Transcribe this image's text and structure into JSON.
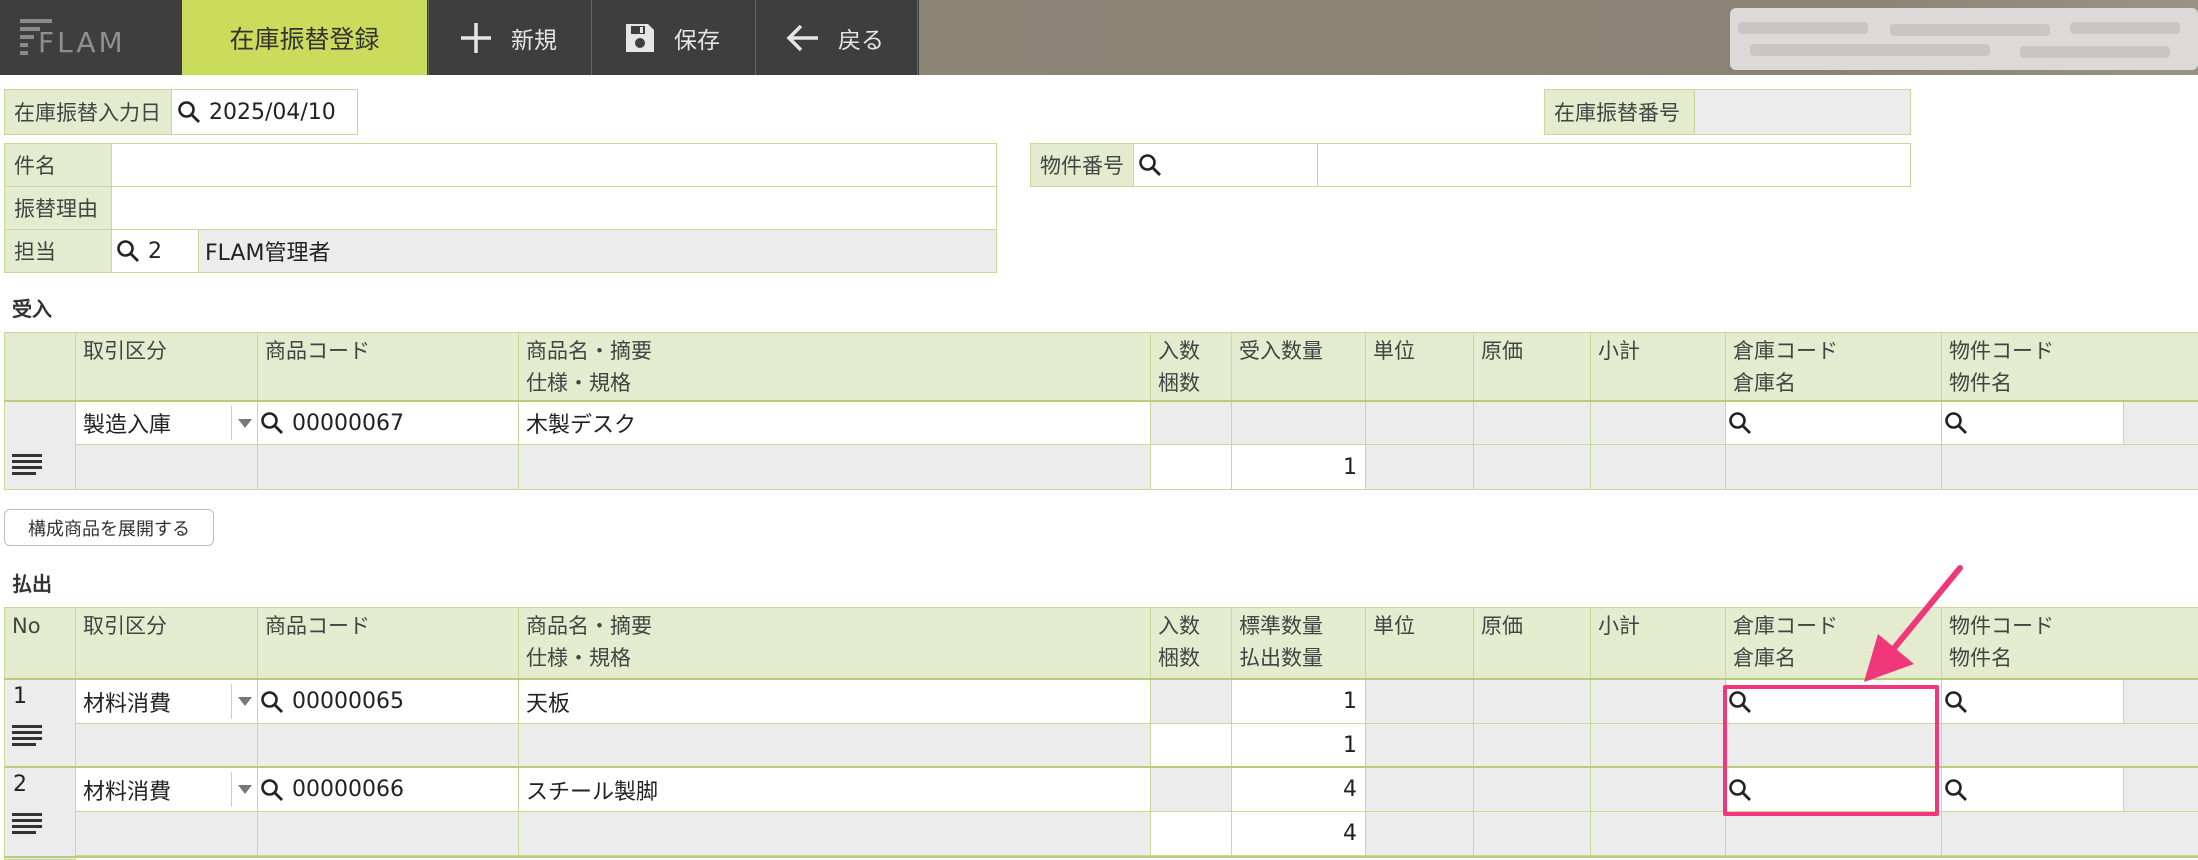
{
  "toolbar": {
    "logo_text": "FLAM",
    "active_tab": "在庫振替登録",
    "new_label": "新規",
    "save_label": "保存",
    "back_label": "戻る"
  },
  "form": {
    "date_label": "在庫振替入力日",
    "date_value": "2025/04/10",
    "number_label": "在庫振替番号",
    "number_value": "",
    "subject_label": "件名",
    "subject_value": "",
    "reason_label": "振替理由",
    "reason_value": "",
    "person_label": "担当",
    "person_code": "2",
    "person_name": "FLAM管理者",
    "property_label": "物件番号",
    "property_code": "",
    "property_name": ""
  },
  "receipt": {
    "title": "受入",
    "headers": {
      "kind": "取引区分",
      "code": "商品コード",
      "name1": "商品名・摘要",
      "name2": "仕様・規格",
      "qty1": "入数",
      "qty2": "梱数",
      "count": "受入数量",
      "unit": "単位",
      "cost": "原価",
      "subtotal": "小計",
      "wh1": "倉庫コード",
      "wh2": "倉庫名",
      "prop1": "物件コード",
      "prop2": "物件名"
    },
    "rows": [
      {
        "kind": "製造入庫",
        "code": "00000067",
        "name": "木製デスク",
        "spec": "",
        "count": "1"
      }
    ]
  },
  "expand_button": "構成商品を展開する",
  "issue": {
    "title": "払出",
    "headers": {
      "no": "No",
      "kind": "取引区分",
      "code": "商品コード",
      "name1": "商品名・摘要",
      "name2": "仕様・規格",
      "qty1": "入数",
      "qty2": "梱数",
      "std1": "標準数量",
      "std2": "払出数量",
      "unit": "単位",
      "cost": "原価",
      "subtotal": "小計",
      "wh1": "倉庫コード",
      "wh2": "倉庫名",
      "prop1": "物件コード",
      "prop2": "物件名"
    },
    "rows": [
      {
        "no": "1",
        "kind": "材料消費",
        "code": "00000065",
        "name": "天板",
        "std": "1",
        "out": "1"
      },
      {
        "no": "2",
        "kind": "材料消費",
        "code": "00000066",
        "name": "スチール製脚",
        "std": "4",
        "out": "4"
      }
    ]
  },
  "colors": {
    "toolbar": "#3e3e3e",
    "active_tab": "#c9dc5c",
    "label_bg": "#e4ebcf",
    "border": "#c8d89a",
    "highlight": "#f0377a"
  }
}
